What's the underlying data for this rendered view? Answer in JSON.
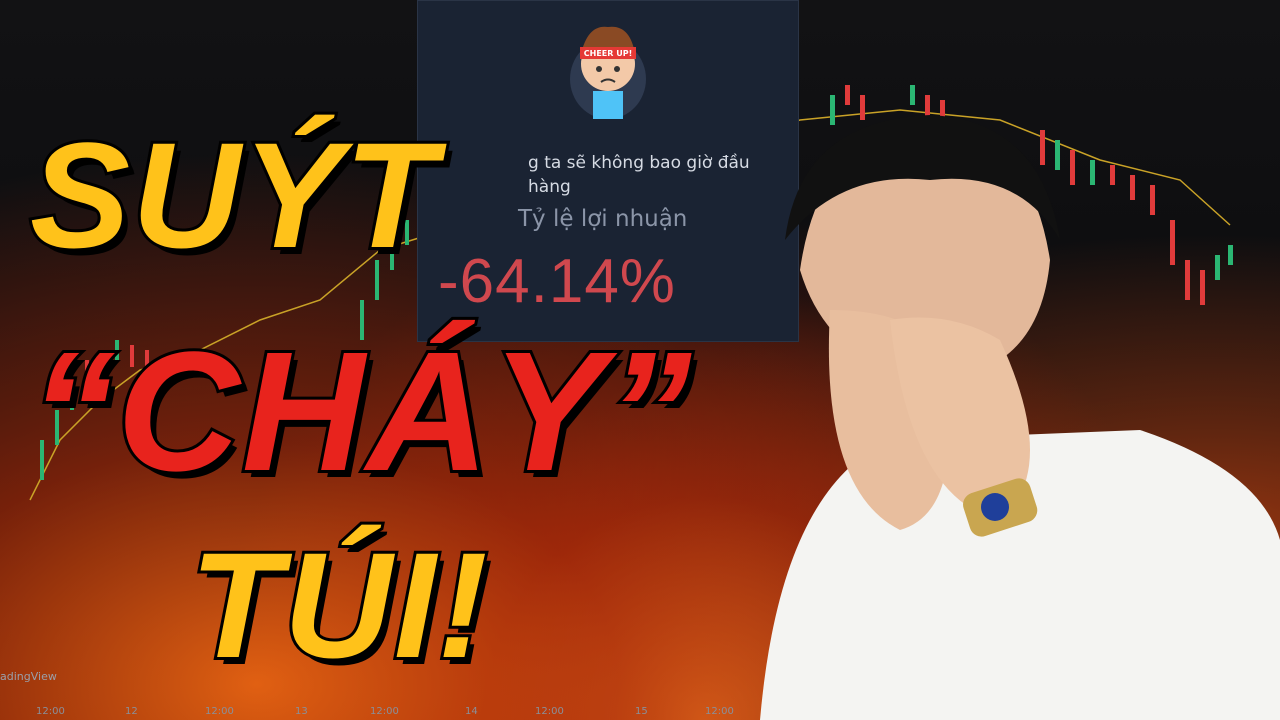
{
  "panel": {
    "message": "g ta sẽ không bao giờ đầu hàng",
    "label": "Tỷ lệ lợi nhuận",
    "value": "-64.14%",
    "badge": "CHEER UP!"
  },
  "headline": {
    "line1": "SUÝT",
    "line2": "“CHÁY”",
    "line3": "TÚI!"
  },
  "watermark": "adingView",
  "axis_labels": [
    "12:00",
    "12",
    "12:00",
    "13",
    "12:00",
    "14",
    "12:00",
    "15",
    "12:00"
  ],
  "colors": {
    "yellow": "#ffc21a",
    "red": "#e8231d",
    "loss": "#d0484e"
  }
}
